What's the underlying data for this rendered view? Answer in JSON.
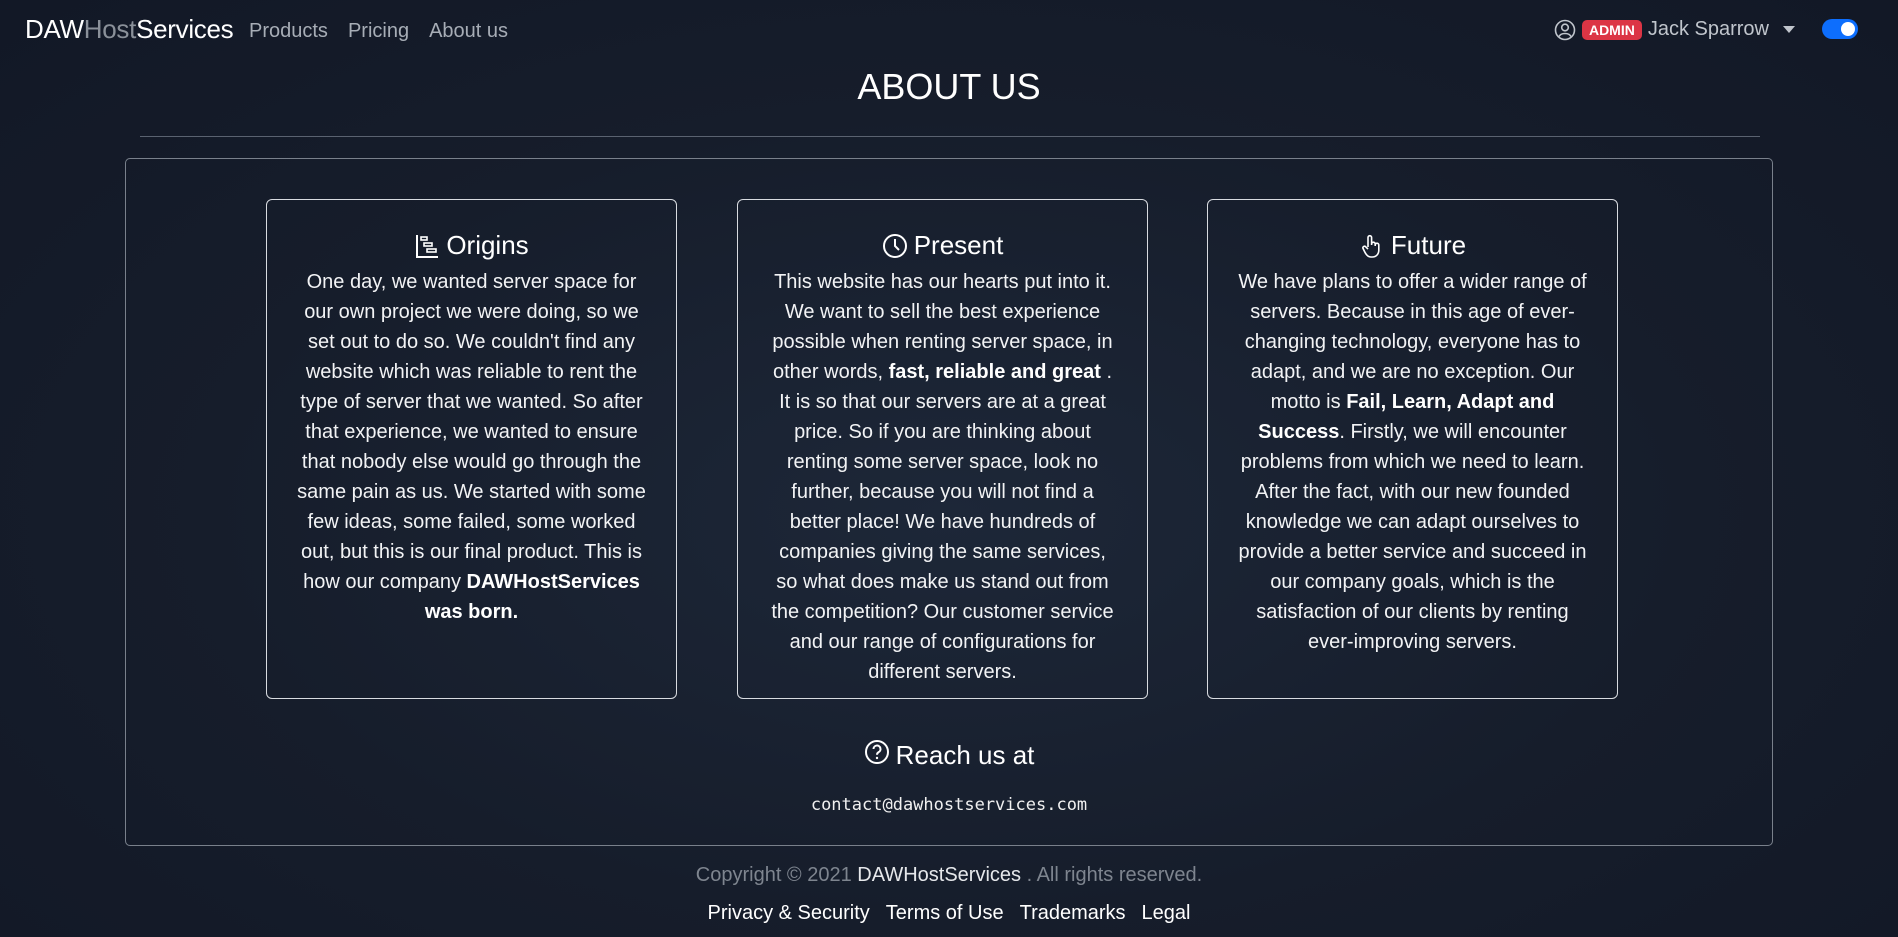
{
  "navbar": {
    "brand_part1": "DAW",
    "brand_part2": "Host",
    "brand_part3": "Services",
    "links": [
      "Products",
      "Pricing",
      "About us"
    ],
    "badge": "ADMIN",
    "username": "Jack Sparrow",
    "toggle_on": true
  },
  "page": {
    "title": "ABOUT US"
  },
  "cards": [
    {
      "icon": "timeline-bars-icon",
      "title": "Origins",
      "text_before": "One day, we wanted server space for our own project we were doing, so we set out to do so. We couldn't find any website which was reliable to rent the type of server that we wanted. So after that experience, we wanted to ensure that nobody else would go through the same pain as us. We started with some few ideas, some failed, some worked out, but this is our final product. This is how our company ",
      "bold": "DAWHostServices was born.",
      "text_after": ""
    },
    {
      "icon": "clock-icon",
      "title": "Present",
      "text_before": "This website has our hearts put into it. We want to sell the best experience possible when renting server space, in other words, ",
      "bold": "fast, reliable and great",
      "text_after": " . It is so that our servers are at a great price. So if you are thinking about renting some server space, look no further, because you will not find a better place! We have hundreds of companies giving the same services, so what does make us stand out from the competition? Our customer service and our range of configurations for different servers."
    },
    {
      "icon": "pointer-hand-icon",
      "title": "Future",
      "text_before": "We have plans to offer a wider range of servers. Because in this age of ever-changing technology, everyone has to adapt, and we are no exception. Our motto is ",
      "bold": "Fail, Learn, Adapt and Success",
      "text_after": ". Firstly, we will encounter problems from which we need to learn. After the fact, with our new founded knowledge we can adapt ourselves to provide a better service and succeed in our company goals, which is the satisfaction of our clients by renting ever-improving servers."
    }
  ],
  "contact": {
    "title": "Reach us at",
    "email": "contact@dawhostservices.com"
  },
  "footer": {
    "copyright_prefix": "Copyright © 2021",
    "company": "DAWHostServices",
    "copyright_suffix": ". All rights reserved.",
    "links": [
      "Privacy & Security",
      "Terms of Use",
      "Trademarks",
      "Legal"
    ]
  },
  "colors": {
    "badge": "#dc3545",
    "toggle": "#0d6efd",
    "background": "#161d2b"
  }
}
